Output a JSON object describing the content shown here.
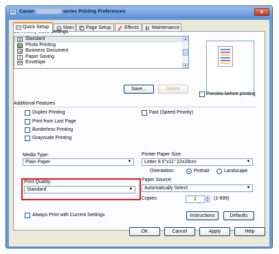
{
  "window": {
    "title_prefix": "Canon",
    "title_suffix": "series Printing Preferences",
    "close_label": "×"
  },
  "tabs": [
    {
      "label": "Quick Setup"
    },
    {
      "label": "Main"
    },
    {
      "label": "Page Setup"
    },
    {
      "label": "Effects"
    },
    {
      "label": "Maintenance"
    }
  ],
  "commonly_used": {
    "label": "Commonly Used Settings",
    "items": [
      "Standard",
      "Photo Printing",
      "Business Document",
      "Paper Saving",
      "Envelope"
    ],
    "save_label": "Save...",
    "delete_label": "Delete"
  },
  "preview_label": "Preview before printing",
  "additional": {
    "label": "Additional Features",
    "duplex": "Duplex Printing",
    "last_page": "Print from Last Page",
    "borderless": "Borderless Printing",
    "grayscale": "Grayscale Printing",
    "fast": "Fast (Speed Priority)"
  },
  "media_type": {
    "label": "Media Type:",
    "value": "Plain Paper"
  },
  "paper_size": {
    "label": "Printer Paper Size:",
    "value": "Letter 8.5\"x11\" 22x28cm"
  },
  "orientation": {
    "label": "Orientation:",
    "portrait": "Portrait",
    "landscape": "Landscape"
  },
  "print_quality": {
    "label": "Print Quality:",
    "value": "Standard"
  },
  "paper_source": {
    "label": "Paper Source:",
    "value": "Automatically Select"
  },
  "copies": {
    "label": "Copies:",
    "value": "1",
    "range": "(1-999)"
  },
  "always_print_label": "Always Print with Current Settings",
  "instructions_label": "Instructions",
  "defaults_label": "Defaults",
  "footer": {
    "ok": "OK",
    "cancel": "Cancel",
    "apply": "Apply",
    "help": "Help"
  },
  "colors": {
    "highlight_box": "#e0161b",
    "tab_accent": "#e68b2c",
    "title_bar": "#5a8ed8"
  }
}
